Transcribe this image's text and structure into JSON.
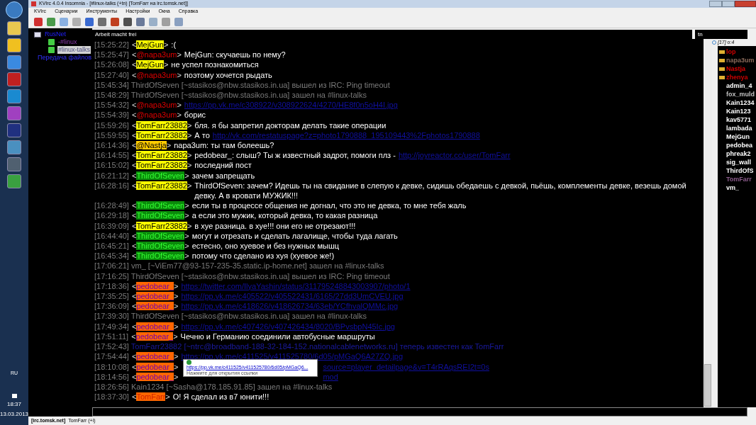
{
  "window": {
    "title": "KVIrc 4.0.4 Insomnia - [#linux-talks (+tn) [TomFarr на irc.tomsk.net]]"
  },
  "menu": [
    "KVIrc",
    "Сценарии",
    "Инструменты",
    "Настройки",
    "Окна",
    "Справка"
  ],
  "tree": [
    {
      "label": "RusNet",
      "kind": "server",
      "selected": false,
      "children": [
        {
          "label": "-#linux",
          "kind": "channel",
          "selected": false
        },
        {
          "label": "#linux-talks",
          "kind": "channel",
          "selected": true
        }
      ]
    },
    {
      "label": "Передача файлов",
      "kind": "transfers",
      "selected": false
    }
  ],
  "topic": {
    "value": "Arbeit macht frei"
  },
  "mode_field": {
    "value": "tn"
  },
  "rows": [
    {
      "time": "[15:25:22]",
      "kind": "message",
      "nick": {
        "open": "<",
        "name": "MejGun",
        "close": ">",
        "kind": "dark-text",
        "color": "#ffff00"
      },
      "text": ":("
    },
    {
      "time": "[15:25:47]",
      "kind": "message",
      "nick": {
        "open": "<",
        "name": "@napa3um",
        "close": ">",
        "kind": "plain",
        "color": "#e00000"
      },
      "text": "MejGun: скучаешь по нему?"
    },
    {
      "time": "[15:26:08]",
      "kind": "message",
      "nick": {
        "open": "<",
        "name": "MejGun",
        "close": ">",
        "kind": "dark-text",
        "color": "#ffff00"
      },
      "text": "не успел познакомиться"
    },
    {
      "time": "[15:27:40]",
      "kind": "message",
      "nick": {
        "open": "<",
        "name": "@napa3um",
        "close": ">",
        "kind": "plain",
        "color": "#e00000"
      },
      "text": "поэтому хочется рыдать"
    },
    {
      "time": "[15:45:34]",
      "kind": "event",
      "text": "ThirdOfSeven [~stasikos@nbw.stasikos.in.ua] вышел из IRC: Ping timeout"
    },
    {
      "time": "[15:48:29]",
      "kind": "event",
      "text": "ThirdOfSeven [~stasikos@nbw.stasikos.in.ua] зашел на #linux-talks"
    },
    {
      "time": "[15:54:32]",
      "kind": "message",
      "nick": {
        "open": "<",
        "name": "@napa3um",
        "close": ">",
        "kind": "plain",
        "color": "#e00000"
      },
      "link": "https://pp.vk.me/c308922/v308922624/4270/HE8f0n5oH4I.jpg"
    },
    {
      "time": "[15:54:39]",
      "kind": "message",
      "nick": {
        "open": "<",
        "name": "@napa3um",
        "close": ">",
        "kind": "plain",
        "color": "#e00000"
      },
      "text": "борис"
    },
    {
      "time": "[15:59:26]",
      "kind": "message",
      "nick": {
        "open": "<",
        "name": "TomFarr23882",
        "close": ">",
        "kind": "dark-text",
        "color": "#ffff00"
      },
      "text": "бля. я бы запретил докторам делать такие операции"
    },
    {
      "time": "[15:59:55]",
      "kind": "message",
      "nick": {
        "open": "<",
        "name": "TomFarr23882",
        "close": ">",
        "kind": "dark-text",
        "color": "#ffff00"
      },
      "text": "А то",
      "link": "http://vk.com/restatuspage?z=photo1790888_195109443%2Fphotos1790888"
    },
    {
      "time": "[16:14:36]",
      "kind": "message",
      "nick": {
        "open": "<",
        "name": "@Nastja",
        "close": ">",
        "kind": "dark-text",
        "color": "#ffcc00"
      },
      "text": "napa3um: ты там болеешь?"
    },
    {
      "time": "[16:14:55]",
      "kind": "message",
      "nick": {
        "open": "<",
        "name": "TomFarr23882",
        "close": ">",
        "kind": "dark-text",
        "color": "#ffff00"
      },
      "text": "pedobear_: слыш? Ты ж известный задрот, помоги плз -",
      "link": "http://joyreactor.cc/user/TomFarr"
    },
    {
      "time": "[16:15:02]",
      "kind": "message",
      "nick": {
        "open": "<",
        "name": "TomFarr23882",
        "close": ">",
        "kind": "dark-text",
        "color": "#ffff00"
      },
      "text": "последний пост"
    },
    {
      "time": "[16:21:12]",
      "kind": "message",
      "nick": {
        "open": "<",
        "name": "ThirdOfSeven",
        "close": ">",
        "kind": "green-text",
        "color": "#0a8a0a"
      },
      "text": "зачем запрещать"
    },
    {
      "time": "[16:28:16]",
      "kind": "message",
      "nick": {
        "open": "<",
        "name": "TomFarr23882",
        "close": ">",
        "kind": "dark-text",
        "color": "#ffff00"
      },
      "text": "ThirdOfSeven: зачем? Идешь ты на свидание в слепую к девке, сидишь обедаешь с девкой, пьёшь, комплементы девке, везешь домой девку. А в кровати МУЖИК!!!"
    },
    {
      "time": "[16:28:49]",
      "kind": "message",
      "nick": {
        "open": "<",
        "name": "ThirdOfSeven",
        "close": ">",
        "kind": "green-text",
        "color": "#0a8a0a"
      },
      "text": "если ты в процессе общения не догнал, что это не девка, то мне тебя жаль"
    },
    {
      "time": "[16:29:18]",
      "kind": "message",
      "nick": {
        "open": "<",
        "name": "ThirdOfSeven",
        "close": ">",
        "kind": "green-text",
        "color": "#0a8a0a"
      },
      "text": "а если это мужик, который девка, то какая разница"
    },
    {
      "time": "[16:39:09]",
      "kind": "message",
      "nick": {
        "open": "<",
        "name": "TomFarr23882",
        "close": ">",
        "kind": "dark-text",
        "color": "#ffff00"
      },
      "text": "в хуе разница. в хуе!!! они его не отрезают!!!"
    },
    {
      "time": "[16:44:40]",
      "kind": "message",
      "nick": {
        "open": "<",
        "name": "ThirdOfSeven",
        "close": ">",
        "kind": "green-text",
        "color": "#0a8a0a"
      },
      "text": "могут и отрезать и сделать лагалище, чтобы туда лагать"
    },
    {
      "time": "[16:45:21]",
      "kind": "message",
      "nick": {
        "open": "<",
        "name": "ThirdOfSeven",
        "close": ">",
        "kind": "green-text",
        "color": "#0a8a0a"
      },
      "text": "естесно, оно хуевое и без нужных мышц"
    },
    {
      "time": "[16:45:34]",
      "kind": "message",
      "nick": {
        "open": "<",
        "name": "ThirdOfSeven",
        "close": ">",
        "kind": "green-text",
        "color": "#0a8a0a"
      },
      "text": "потому что сделано из хуя (хуевое же!)"
    },
    {
      "time": "[17:06:21]",
      "kind": "event",
      "text": "vm_ [~ViEm77@93-157-235-35.static.ip-home.net] зашел на #linux-talks"
    },
    {
      "time": "[17:16:25]",
      "kind": "event",
      "text": "ThirdOfSeven [~stasikos@nbw.stasikos.in.ua] вышел из IRC: Ping timeout"
    },
    {
      "time": "[17:18:36]",
      "kind": "message",
      "nick": {
        "open": "<",
        "name": "pedobear_",
        "close": ">",
        "kind": "purple-text",
        "color": "#ff6600"
      },
      "link": "https://twitter.com/IlyaYashin/status/311795248843003907/photo/1"
    },
    {
      "time": "[17:35:25]",
      "kind": "message",
      "nick": {
        "open": "<",
        "name": "pedobear_",
        "close": ">",
        "kind": "purple-text",
        "color": "#ff6600"
      },
      "link": "https://pp.vk.me/c405522/v405522431/6165/27dd3UmCVEU.jpg"
    },
    {
      "time": "[17:36:09]",
      "kind": "message",
      "nick": {
        "open": "<",
        "name": "pedobear_",
        "close": ">",
        "kind": "purple-text",
        "color": "#ff6600"
      },
      "link": "https://pp.vk.me/c418626/v418626734/63eb/YCfhvalQMMc.jpg"
    },
    {
      "time": "[17:39:30]",
      "kind": "event",
      "text": "ThirdOfSeven [~stasikos@nbw.stasikos.in.ua] зашел на #linux-talks"
    },
    {
      "time": "[17:49:34]",
      "kind": "message",
      "nick": {
        "open": "<",
        "name": "pedobear_",
        "close": ">",
        "kind": "purple-text",
        "color": "#ff6600"
      },
      "link": "https://pp.vk.me/c407426/v407426434/8020/BPvsbpN45Ic.jpg"
    },
    {
      "time": "[17:51:11]",
      "kind": "message",
      "nick": {
        "open": "<",
        "name": "pedobear_",
        "close": ">",
        "kind": "purple-text",
        "color": "#ff6600"
      },
      "text": "Чечню и Германию соединили автобусные маршруты"
    },
    {
      "time": "[17:52:43]",
      "kind": "nickchange",
      "text": "TomFarr23882 [~ntrc@broadband-188-32-184-152.nationalcablenetworks.ru] теперь известен как TomFarr"
    },
    {
      "time": "[17:54:44]",
      "kind": "message",
      "nick": {
        "open": "<",
        "name": "pedobear_",
        "close": ">",
        "kind": "purple-text",
        "color": "#ff6600"
      },
      "link": "https://pp.vk.me/c411525/v411525780/6d05/pMGaQ6A27ZQ.jpg"
    },
    {
      "time": "[18:10:08]",
      "kind": "covered",
      "nick": {
        "open": "<",
        "name": "pedobear_",
        "close": ">",
        "kind": "purple-text",
        "color": "#ff6600"
      },
      "link": "source=player_detailpage&v=T4rRAqsREI2t=0s",
      "tooltip": {
        "url": "https://pp.vk.me/c411525/v411525780/6d05/pMGaQ6...",
        "hint": "Нажмите для открытия ссылки"
      }
    },
    {
      "time": "[18:14:56]",
      "kind": "covered",
      "nick": {
        "open": "<",
        "name": "pedobear_",
        "close": ">",
        "kind": "purple-text",
        "color": "#ff6600"
      },
      "link": "mod"
    },
    {
      "time": "[18:26:56]",
      "kind": "event",
      "text": "Kain1234 [~Sasha@178.185.91.85] зашел на #linux-talks"
    },
    {
      "time": "[18:37:30]",
      "kind": "message",
      "nick": {
        "open": "<",
        "name": "TomFarr",
        "close": ">",
        "kind": "red-text",
        "color": "#ff6600"
      },
      "text": "О! Я сделал из в7 юнити!!!"
    }
  ],
  "nicklist": {
    "count": "[17] o:4",
    "users": [
      {
        "name": "lop",
        "op": true,
        "color": "#cc0000"
      },
      {
        "name": "napa3um",
        "op": true,
        "color": "#8a6a5a"
      },
      {
        "name": "Nastja",
        "op": true,
        "color": "#dd0000"
      },
      {
        "name": "zhenya",
        "op": true,
        "color": "#cc0000"
      },
      {
        "name": "admin_4",
        "op": false,
        "color": "#ffffff"
      },
      {
        "name": "fox_muld",
        "op": false,
        "color": "#c0c0c0"
      },
      {
        "name": "Kain1234",
        "op": false,
        "color": "#ffffff"
      },
      {
        "name": "Kain123",
        "op": false,
        "color": "#ffffff"
      },
      {
        "name": "kav5771",
        "op": false,
        "color": "#ffffff"
      },
      {
        "name": "lambada",
        "op": false,
        "color": "#ffffff"
      },
      {
        "name": "MejGun",
        "op": false,
        "color": "#ffffff"
      },
      {
        "name": "pedobea",
        "op": false,
        "color": "#ffffff"
      },
      {
        "name": "phreak2",
        "op": false,
        "color": "#ffffff"
      },
      {
        "name": "sig_wall",
        "op": false,
        "color": "#ffffff"
      },
      {
        "name": "ThirdOfS",
        "op": false,
        "color": "#ffffff"
      },
      {
        "name": "TomFarr",
        "op": false,
        "color": "#8a5a8a"
      },
      {
        "name": "vm_",
        "op": false,
        "color": "#ffffff"
      }
    ]
  },
  "taskbar": {
    "language": "RU",
    "time": "18:37",
    "date": "13.03.2013"
  },
  "status_bar": {
    "server": "[irc.tomsk.net]",
    "user": "TomFarr (+i)"
  }
}
